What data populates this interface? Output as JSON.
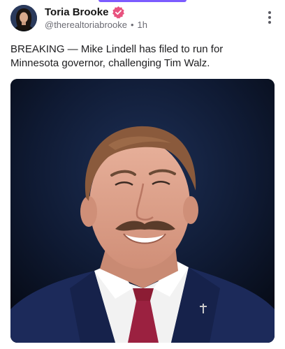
{
  "post": {
    "author": {
      "display_name": "Toria Brooke",
      "handle": "@therealtoriabrooke",
      "separator": "•",
      "time": "1h",
      "verified_icon": "verified-badge-icon",
      "verified_color": "#e8537f"
    },
    "more_icon": "more-vertical-icon",
    "text": "BREAKING — Mike Lindell has filed to run for Minnesota governor, challenging Tim Walz.",
    "image": {
      "subject": "photo-of-man-in-suit"
    }
  },
  "colors": {
    "accent": "#7c5cff",
    "text_primary": "#151515",
    "text_secondary": "#6b6b73"
  }
}
